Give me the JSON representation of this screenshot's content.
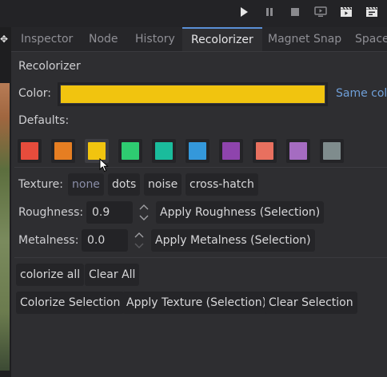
{
  "toolbar": {
    "buttons": [
      "play-icon",
      "pause-icon",
      "stop-icon",
      "play-scene-icon",
      "movie-icon",
      "movie-custom-icon"
    ]
  },
  "tabs": [
    "Inspector",
    "Node",
    "History",
    "Recolorizer",
    "Magnet Snap",
    "Space"
  ],
  "active_tab": "Recolorizer",
  "panel": {
    "title": "Recolorizer",
    "color_label": "Color:",
    "current_color": "#f1c40f",
    "same_color_label": "Same colo",
    "defaults_label": "Defaults:",
    "defaults": [
      {
        "name": "red",
        "color": "#e74c3c"
      },
      {
        "name": "orange",
        "color": "#e67e22"
      },
      {
        "name": "yellow",
        "color": "#f1c40f",
        "selected": true
      },
      {
        "name": "green",
        "color": "#2ecc71"
      },
      {
        "name": "teal",
        "color": "#1abc9c"
      },
      {
        "name": "blue",
        "color": "#3498db"
      },
      {
        "name": "purple",
        "color": "#8e44ad"
      },
      {
        "name": "salmon",
        "color": "#e8705f"
      },
      {
        "name": "violet",
        "color": "#a56cc1"
      },
      {
        "name": "gray",
        "color": "#7f8c8d"
      }
    ],
    "texture_label": "Texture:",
    "textures": [
      "none",
      "dots",
      "noise",
      "cross-hatch"
    ],
    "selected_texture": "none",
    "roughness_label": "Roughness:",
    "roughness_value": "0.9",
    "apply_roughness": "Apply Roughness (Selection)",
    "metalness_label": "Metalness:",
    "metalness_value": "0.0",
    "apply_metalness": "Apply Metalness (Selection)",
    "colorize_all": "colorize all",
    "clear_all": "Clear All",
    "colorize_selection": "Colorize Selection",
    "apply_texture": "Apply Texture (Selection)",
    "clear_selection": "Clear Selection"
  }
}
